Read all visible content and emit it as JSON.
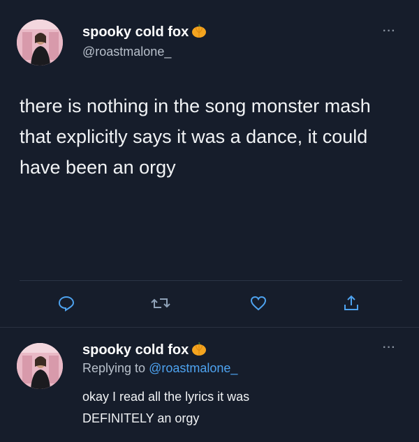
{
  "main_tweet": {
    "display_name": "spooky cold fox",
    "handle": "@roastmalone_",
    "more": "···",
    "text": "there is nothing in the song monster mash that explicitly says it was a dance, it could have been an orgy",
    "actions": [
      "reply-icon",
      "retweet-icon",
      "like-icon",
      "share-icon"
    ]
  },
  "reply_tweet": {
    "display_name": "spooky cold fox",
    "replying_prefix": "Replying to ",
    "replying_handle": "@roastmalone_",
    "more": "···",
    "text_line1": "okay I read all the lyrics it was",
    "text_line2": "DEFINITELY an orgy"
  },
  "colors": {
    "background": "#161d2b",
    "secondary_text": "#b8c0cb",
    "mention": "#4ea3f0",
    "icon": "#4ea3f0"
  }
}
